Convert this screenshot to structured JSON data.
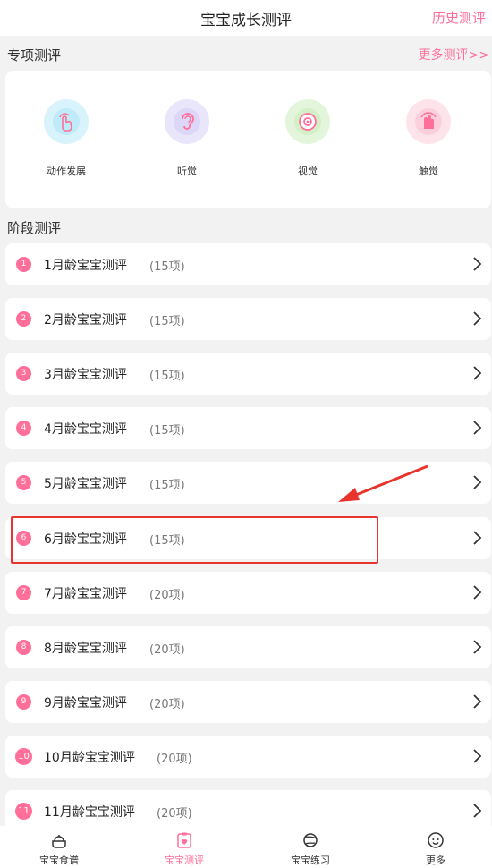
{
  "header": {
    "title": "宝宝成长测评",
    "history_link": "历史测评"
  },
  "special": {
    "title": "专项测评",
    "more_link": "更多测评>>",
    "items": [
      {
        "label": "动作发展",
        "icon": "hand-tap-icon"
      },
      {
        "label": "听觉",
        "icon": "ear-icon"
      },
      {
        "label": "视觉",
        "icon": "eye-icon"
      },
      {
        "label": "触觉",
        "icon": "touch-icon"
      }
    ]
  },
  "stages": {
    "title": "阶段测评",
    "items": [
      {
        "num": "1",
        "title": "1月龄宝宝测评",
        "count": "(15项)"
      },
      {
        "num": "2",
        "title": "2月龄宝宝测评",
        "count": "(15项)"
      },
      {
        "num": "3",
        "title": "3月龄宝宝测评",
        "count": "(15项)"
      },
      {
        "num": "4",
        "title": "4月龄宝宝测评",
        "count": "(15项)"
      },
      {
        "num": "5",
        "title": "5月龄宝宝测评",
        "count": "(15项)"
      },
      {
        "num": "6",
        "title": "6月龄宝宝测评",
        "count": "(15项)"
      },
      {
        "num": "7",
        "title": "7月龄宝宝测评",
        "count": "(20项)"
      },
      {
        "num": "8",
        "title": "8月龄宝宝测评",
        "count": "(20项)"
      },
      {
        "num": "9",
        "title": "9月龄宝宝测评",
        "count": "(20项)"
      },
      {
        "num": "10",
        "title": "10月龄宝宝测评",
        "count": "(20项)"
      },
      {
        "num": "11",
        "title": "11月龄宝宝测评",
        "count": "(20项)"
      }
    ]
  },
  "tabbar": {
    "items": [
      {
        "label": "宝宝食谱",
        "icon": "recipe-icon",
        "active": false
      },
      {
        "label": "宝宝测评",
        "icon": "assessment-icon",
        "active": true
      },
      {
        "label": "宝宝练习",
        "icon": "practice-icon",
        "active": false
      },
      {
        "label": "更多",
        "icon": "more-icon",
        "active": false
      }
    ]
  },
  "colors": {
    "accent": "#ff6f9a",
    "annotation": "#e8342d"
  }
}
